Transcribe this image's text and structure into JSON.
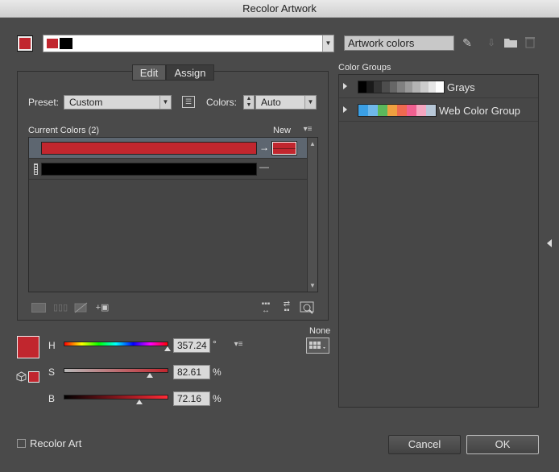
{
  "window": {
    "title": "Recolor Artwork"
  },
  "top": {
    "colors_name": "Artwork colors"
  },
  "tabs": [
    {
      "label": "Edit"
    },
    {
      "label": "Assign"
    }
  ],
  "preset": {
    "label": "Preset:",
    "value": "Custom"
  },
  "colors": {
    "label": "Colors:",
    "value": "Auto"
  },
  "current_colors": {
    "header": "Current Colors (2)",
    "new_label": "New",
    "rows": [
      {
        "color": "#c1262e",
        "new_color": "#c1262e",
        "arrow": "→"
      },
      {
        "color": "#000000",
        "new_color": "",
        "arrow": "—"
      }
    ]
  },
  "hsb": {
    "h": {
      "label": "H",
      "value": "357.24",
      "unit": "°",
      "fraction": 0.992
    },
    "s": {
      "label": "S",
      "value": "82.61",
      "unit": "%",
      "fraction": 0.826
    },
    "b": {
      "label": "B",
      "value": "72.16",
      "unit": "%",
      "fraction": 0.722
    },
    "current_color": "#c1262e"
  },
  "none_label": "None",
  "color_groups": {
    "header": "Color Groups",
    "items": [
      {
        "name": "Grays",
        "swatches": [
          "#000000",
          "#1a1a1a",
          "#333333",
          "#4d4d4d",
          "#666666",
          "#808080",
          "#999999",
          "#b3b3b3",
          "#cccccc",
          "#e6e6e6",
          "#ffffff"
        ]
      },
      {
        "name": "Web Color Group",
        "swatches": [
          "#3ba0e6",
          "#6fb8ea",
          "#5cb85c",
          "#f0a040",
          "#ef6a50",
          "#f06090",
          "#f4a6c0",
          "#b8c8d8"
        ]
      }
    ]
  },
  "recolor_art": {
    "label": "Recolor Art",
    "checked": false
  },
  "buttons": {
    "cancel": "Cancel",
    "ok": "OK"
  }
}
